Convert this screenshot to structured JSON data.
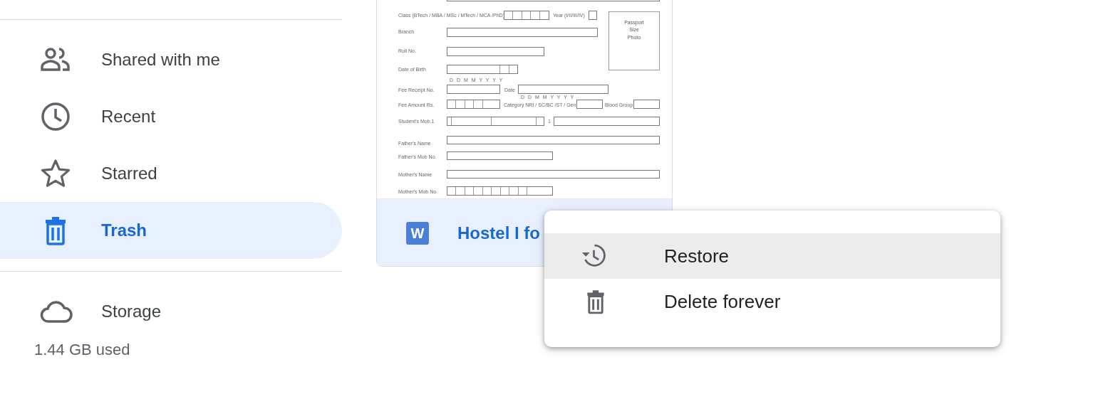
{
  "sidebar": {
    "items": [
      {
        "label": "Shared with me",
        "selected": false
      },
      {
        "label": "Recent",
        "selected": false
      },
      {
        "label": "Starred",
        "selected": false
      },
      {
        "label": "Trash",
        "selected": true
      }
    ],
    "storage": {
      "label": "Storage",
      "usage": "1.44 GB used"
    }
  },
  "file_card": {
    "selected": true,
    "file_type": "W",
    "name": "Hostel I fo",
    "preview": {
      "photo": "Passport Size Photo",
      "rows": [
        {
          "kind": "class",
          "label": "Class (BTech / MBA / MSc / MTech / MCA /PhD)",
          "extra": "Year (I/II/III/IV)"
        },
        {
          "kind": "branch",
          "label": "Branch"
        },
        {
          "kind": "roll",
          "label": "Roll No."
        },
        {
          "kind": "dob",
          "label": "Date of Birth",
          "hint": "D D M M Y Y Y Y"
        },
        {
          "kind": "receipt",
          "label": "Fee Receipt No.",
          "extra": "Date",
          "hint": "D D M M Y Y Y Y"
        },
        {
          "kind": "amount",
          "label": "Fee Amount Rs.",
          "extra": "Category  NRI / SC/BC /ST / Gen",
          "extra2": "Blood Group"
        },
        {
          "kind": "mobile",
          "label": "Student's Mob.1",
          "extra": "1"
        },
        {
          "kind": "father_name",
          "label": "Father's Name"
        },
        {
          "kind": "father_mob",
          "label": "Father's Mob No."
        },
        {
          "kind": "mother_name",
          "label": "Mother's Name"
        },
        {
          "kind": "mother_mob",
          "label": "Mother's Mob No."
        }
      ]
    }
  },
  "context_menu": {
    "items": [
      {
        "label": "Restore",
        "highlighted": true
      },
      {
        "label": "Delete forever",
        "highlighted": false
      }
    ]
  }
}
